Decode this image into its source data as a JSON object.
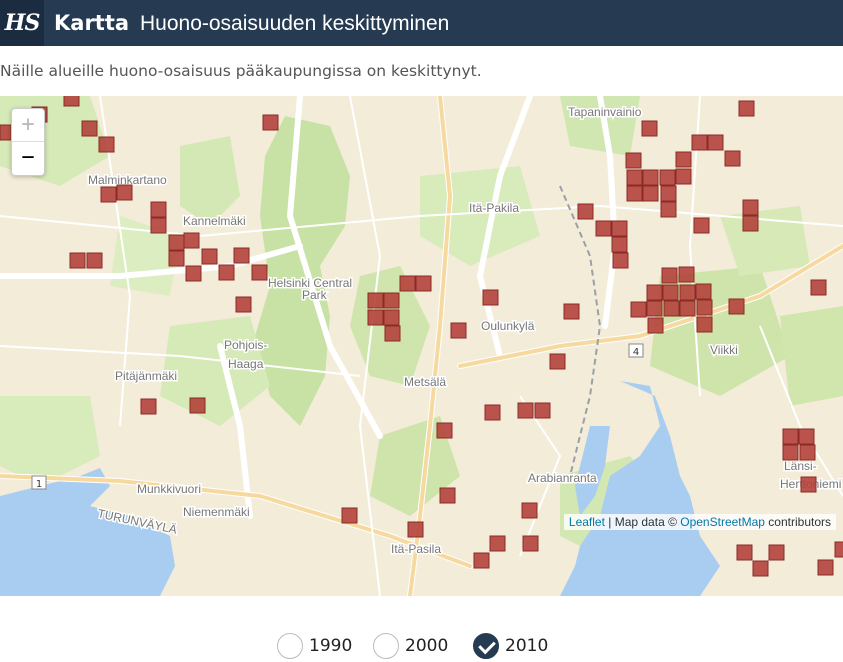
{
  "header": {
    "logo": "HS",
    "title_strong": "Kartta",
    "title_rest": "Huono-osaisuuden keskittyminen"
  },
  "subtitle": "Näille alueille huono-osaisuus pääkaupungissa on keskittynyt.",
  "map": {
    "zoom_in": "+",
    "zoom_out": "−",
    "attribution_leaflet": "Leaflet",
    "attribution_sep": " | Map data © ",
    "attribution_osm": "OpenStreetMap",
    "attribution_tail": " contributors",
    "place_labels": [
      "Tapaninvainio",
      "Malminkartano",
      "Kannelmäki",
      "Itä-Pakila",
      "Helsinki Central",
      "Park",
      "Pohjois-",
      "Haaga",
      "Oulunkylä",
      "Pitäjänmäki",
      "Viikki",
      "Metsälä",
      "Arabianranta",
      "Munkkivuori",
      "Niemenmäki",
      "TURUNVÄYLÄ",
      "Länsi-",
      "Herttoniemi",
      "Itä-Pasila"
    ],
    "road_shields": [
      "1",
      "4"
    ],
    "marker_color": "#b3423b"
  },
  "years": [
    {
      "label": "1990",
      "selected": false
    },
    {
      "label": "2000",
      "selected": false
    },
    {
      "label": "2010",
      "selected": true
    }
  ]
}
